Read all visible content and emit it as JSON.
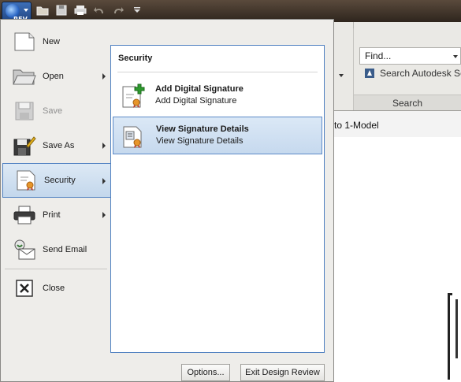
{
  "app": {
    "logo_text": "REV",
    "find_placeholder": "Find...",
    "search_label": "Search Autodesk Se",
    "search_group_label": "Search",
    "document_tab": "to 1-Model"
  },
  "app_menu": {
    "items": [
      {
        "label": "New"
      },
      {
        "label": "Open"
      },
      {
        "label": "Save"
      },
      {
        "label": "Save As"
      },
      {
        "label": "Security"
      },
      {
        "label": "Print"
      },
      {
        "label": "Send Email"
      },
      {
        "label": "Close"
      }
    ]
  },
  "submenu": {
    "header": "Security",
    "items": [
      {
        "title": "Add Digital Signature",
        "description": "Add Digital Signature"
      },
      {
        "title": "View Signature Details",
        "description": "View Signature Details"
      }
    ]
  },
  "footer": {
    "options_label": "Options...",
    "exit_label": "Exit Design Review"
  },
  "colors": {
    "selection_border": "#4e7fc0",
    "selection_fill": "#c6d9ee",
    "menu_background": "#eeedea"
  }
}
